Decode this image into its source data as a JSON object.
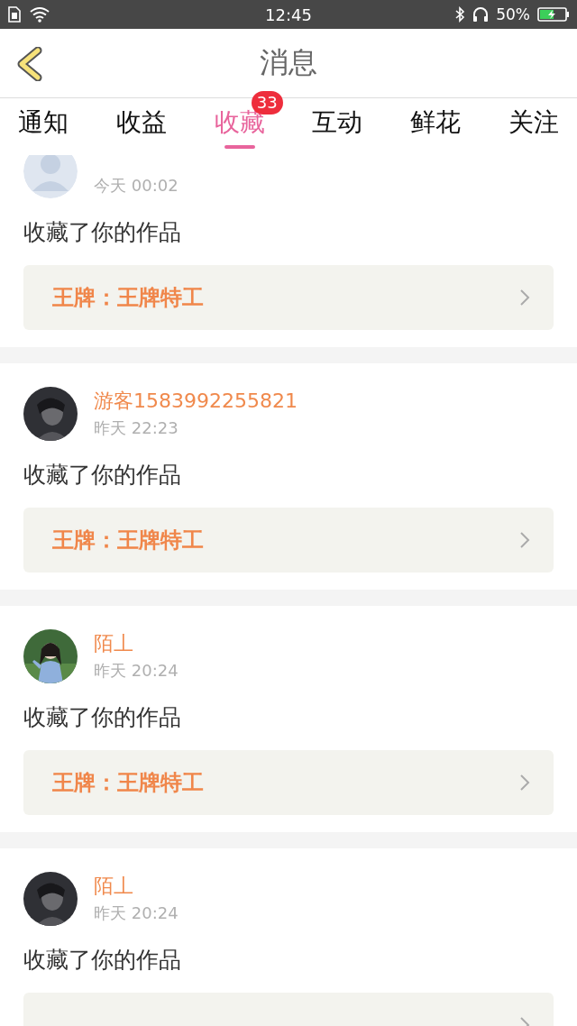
{
  "status_bar": {
    "time": "12:45",
    "battery_text": "50%"
  },
  "header": {
    "title": "消息"
  },
  "tabs": [
    {
      "label": "通知",
      "selected": false
    },
    {
      "label": "收益",
      "selected": false
    },
    {
      "label": "收藏",
      "selected": true,
      "badge": "33"
    },
    {
      "label": "互动",
      "selected": false
    },
    {
      "label": "鲜花",
      "selected": false
    },
    {
      "label": "关注",
      "selected": false
    }
  ],
  "messages": [
    {
      "kind": "default",
      "time": "今天 00:02",
      "text": "收藏了你的作品",
      "work": "王牌：王牌特工"
    },
    {
      "name": "游客1583992255821",
      "time": "昨天 22:23",
      "text": "收藏了你的作品",
      "work": "王牌：王牌特工"
    },
    {
      "name": "陌丄",
      "time": "昨天 20:24",
      "text": "收藏了你的作品",
      "work": "王牌：王牌特工"
    },
    {
      "name": "陌丄",
      "time": "昨天 20:24",
      "text": "收藏了你的作品"
    }
  ]
}
